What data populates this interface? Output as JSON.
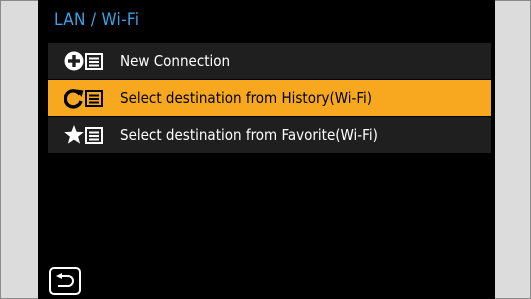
{
  "header": {
    "title": "LAN / Wi-Fi"
  },
  "menu": {
    "items": [
      {
        "label": "New Connection",
        "icon": "new-connection-icon",
        "selected": false
      },
      {
        "label": "Select destination from History(Wi-Fi)",
        "icon": "history-icon",
        "selected": true
      },
      {
        "label": "Select destination from Favorite(Wi-Fi)",
        "icon": "favorite-icon",
        "selected": false
      }
    ]
  },
  "footer": {
    "back_icon": "return-icon"
  },
  "colors": {
    "title": "#3aa2e8",
    "selected_bg": "#f7a81e",
    "item_bg": "#1f1f1f",
    "screen_bg": "#000000",
    "frame_bg": "#dcdcdc"
  }
}
